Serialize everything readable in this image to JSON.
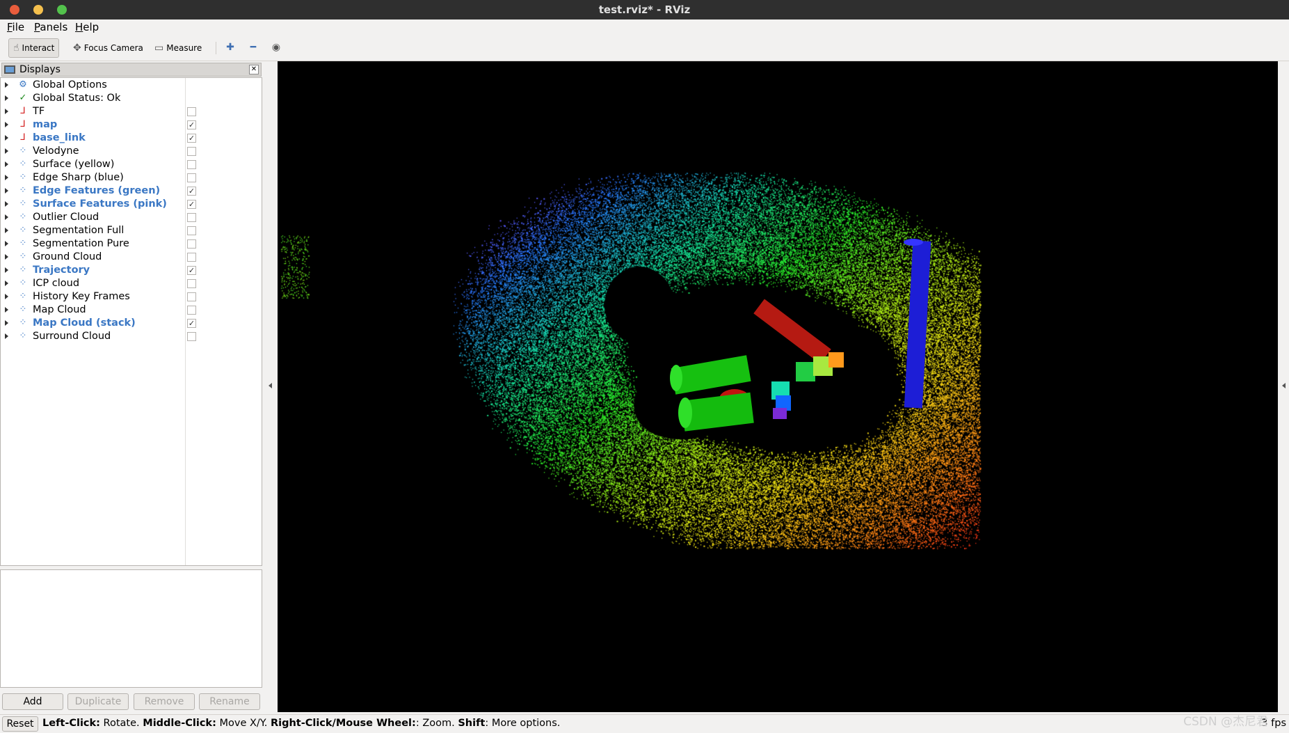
{
  "window": {
    "title": "test.rviz* - RViz"
  },
  "menubar": [
    {
      "label": "File",
      "mnemonic": "F",
      "rest": "ile"
    },
    {
      "label": "Panels",
      "mnemonic": "P",
      "rest": "anels"
    },
    {
      "label": "Help",
      "mnemonic": "H",
      "rest": "elp"
    }
  ],
  "toolbar": {
    "interact": "Interact",
    "focus_camera": "Focus Camera",
    "measure": "Measure"
  },
  "displays_panel": {
    "title": "Displays",
    "items": [
      {
        "label": "Global Options",
        "icon": "gear-icon",
        "checkbox": null
      },
      {
        "label": "Global Status: Ok",
        "icon": "checkmark-icon",
        "checkbox": null
      },
      {
        "label": "TF",
        "icon": "axes-icon",
        "checkbox": false
      },
      {
        "label": "map",
        "icon": "axes-icon",
        "checkbox": true
      },
      {
        "label": "base_link",
        "icon": "axes-icon",
        "checkbox": true
      },
      {
        "label": "Velodyne",
        "icon": "pointcloud-icon",
        "checkbox": false
      },
      {
        "label": "Surface (yellow)",
        "icon": "pointcloud-icon",
        "checkbox": false
      },
      {
        "label": "Edge Sharp (blue)",
        "icon": "pointcloud-icon",
        "checkbox": false
      },
      {
        "label": "Edge Features (green)",
        "icon": "pointcloud-icon",
        "checkbox": true
      },
      {
        "label": "Surface Features (pink)",
        "icon": "pointcloud-icon",
        "checkbox": true
      },
      {
        "label": "Outlier Cloud",
        "icon": "pointcloud-icon",
        "checkbox": false
      },
      {
        "label": "Segmentation Full",
        "icon": "pointcloud-icon",
        "checkbox": false
      },
      {
        "label": "Segmentation Pure",
        "icon": "pointcloud-icon",
        "checkbox": false
      },
      {
        "label": "Ground Cloud",
        "icon": "pointcloud-icon",
        "checkbox": false
      },
      {
        "label": "Trajectory",
        "icon": "pointcloud-icon",
        "checkbox": true
      },
      {
        "label": "ICP cloud",
        "icon": "pointcloud-icon",
        "checkbox": false
      },
      {
        "label": "History Key Frames",
        "icon": "pointcloud-icon",
        "checkbox": false
      },
      {
        "label": "Map Cloud",
        "icon": "pointcloud-icon",
        "checkbox": false
      },
      {
        "label": "Map Cloud (stack)",
        "icon": "pointcloud-icon",
        "checkbox": true
      },
      {
        "label": "Surround Cloud",
        "icon": "pointcloud-icon",
        "checkbox": false
      }
    ],
    "buttons": {
      "add": "Add",
      "duplicate": "Duplicate",
      "remove": "Remove",
      "rename": "Rename"
    }
  },
  "statusbar": {
    "reset": "Reset",
    "hints": [
      {
        "bold": "Left-Click:",
        "text": " Rotate. "
      },
      {
        "bold": "Middle-Click:",
        "text": " Move X/Y. "
      },
      {
        "bold": "Right-Click/Mouse Wheel:",
        "text": ": Zoom. "
      },
      {
        "bold": "Shift",
        "text": ": More options."
      }
    ],
    "fps": "3 fps"
  },
  "watermark": "CSDN @杰尼君",
  "colors": {
    "enabled_label": "#3a77c4",
    "viewport_bg": "#000000"
  }
}
